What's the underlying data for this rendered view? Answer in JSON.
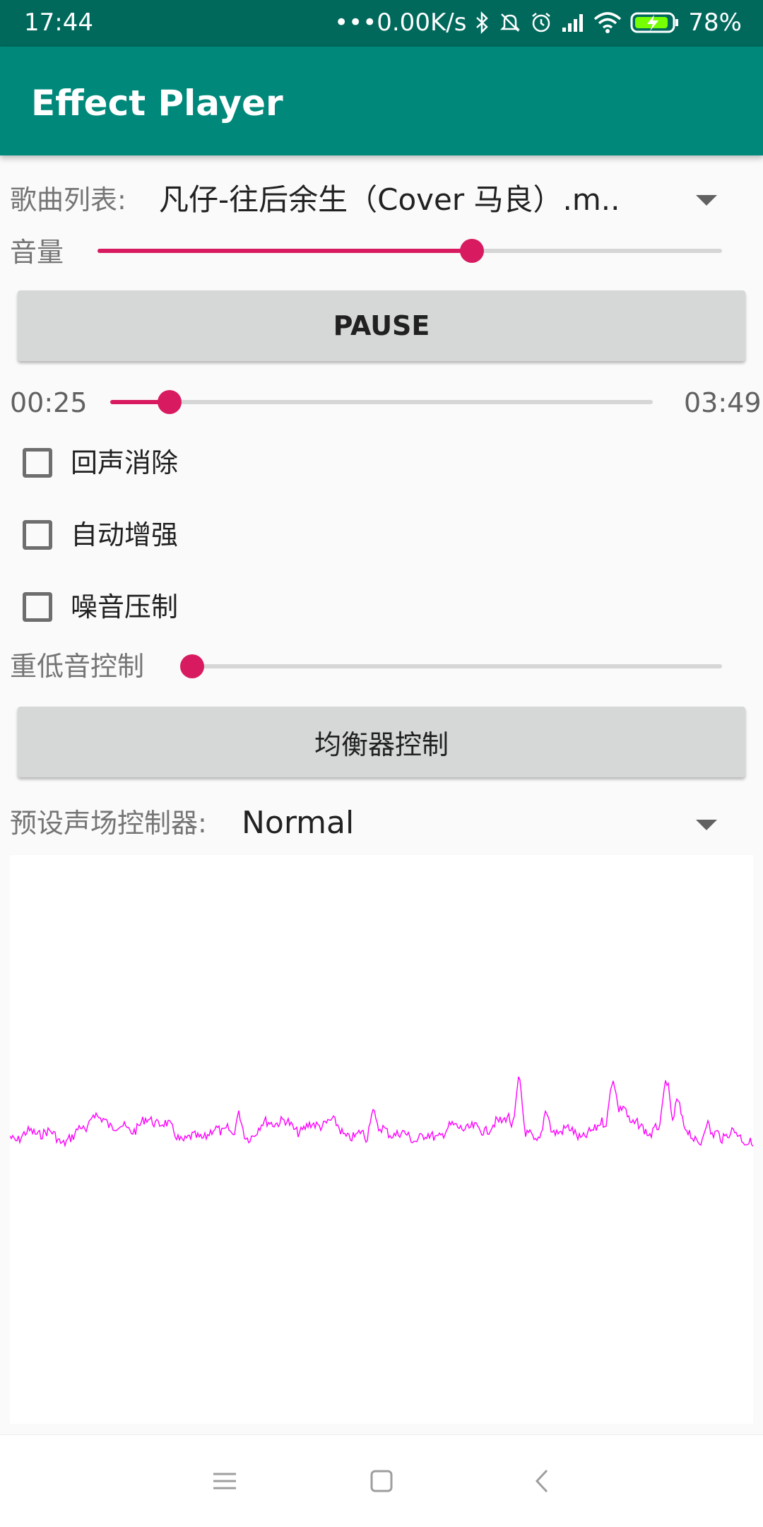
{
  "status_bar": {
    "time": "17:44",
    "network_speed": "•••0.00K/s",
    "battery_percent": "78%",
    "icons": [
      "bluetooth-icon",
      "mute-icon",
      "alarm-icon",
      "signal-icon",
      "wifi-icon",
      "battery-charging-icon"
    ]
  },
  "app_bar": {
    "title": "Effect Player",
    "color": "#00897b"
  },
  "song_list": {
    "label": "歌曲列表:",
    "selected": "凡仔-往后余生（Cover 马良）.m.."
  },
  "volume": {
    "label": "音量",
    "value_fraction": 0.6
  },
  "pause_button": {
    "label": "PAUSE"
  },
  "progress": {
    "current": "00:25",
    "total": "03:49",
    "value_fraction": 0.11
  },
  "checkboxes": [
    {
      "label": "回声消除",
      "checked": false
    },
    {
      "label": "自动增强",
      "checked": false
    },
    {
      "label": "噪音压制",
      "checked": false
    }
  ],
  "bass_boost": {
    "label": "重低音控制",
    "value_fraction": 0.0
  },
  "equalizer_button": {
    "label": "均衡器控制"
  },
  "preset": {
    "label": "预设声场控制器:",
    "selected": "Normal"
  },
  "colors": {
    "accent": "#d81b60",
    "waveform": "#ff00ff",
    "status_bar": "#00695c"
  },
  "nav_icons": [
    "menu-icon",
    "home-icon",
    "back-icon"
  ]
}
